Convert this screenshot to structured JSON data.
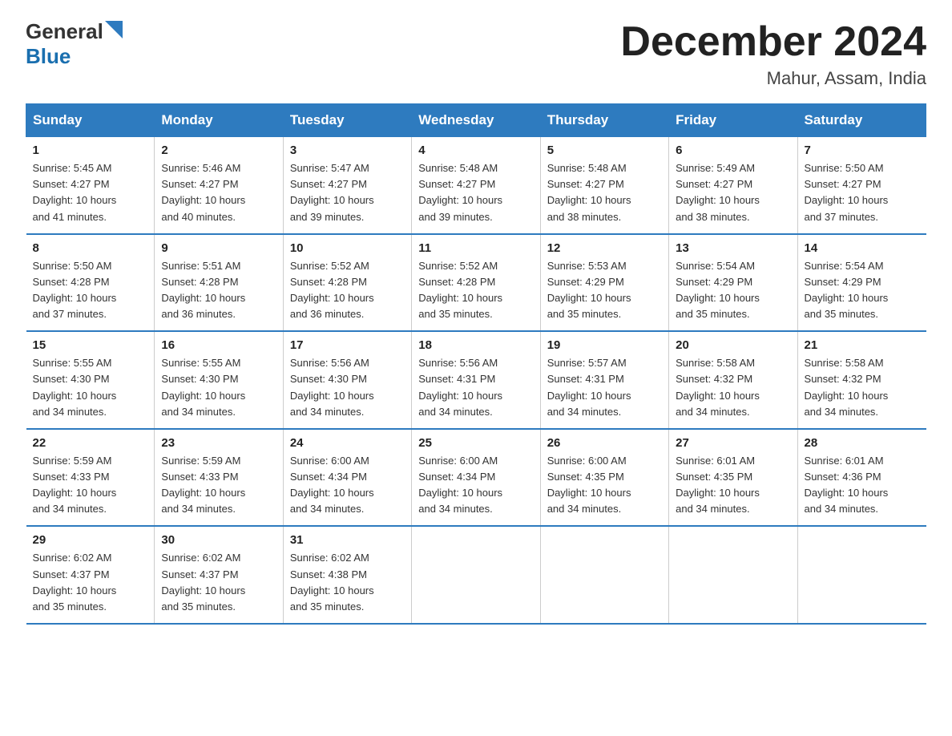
{
  "header": {
    "logo_general": "General",
    "logo_blue": "Blue",
    "month_title": "December 2024",
    "location": "Mahur, Assam, India"
  },
  "days_of_week": [
    "Sunday",
    "Monday",
    "Tuesday",
    "Wednesday",
    "Thursday",
    "Friday",
    "Saturday"
  ],
  "weeks": [
    [
      {
        "day": "1",
        "info": "Sunrise: 5:45 AM\nSunset: 4:27 PM\nDaylight: 10 hours\nand 41 minutes."
      },
      {
        "day": "2",
        "info": "Sunrise: 5:46 AM\nSunset: 4:27 PM\nDaylight: 10 hours\nand 40 minutes."
      },
      {
        "day": "3",
        "info": "Sunrise: 5:47 AM\nSunset: 4:27 PM\nDaylight: 10 hours\nand 39 minutes."
      },
      {
        "day": "4",
        "info": "Sunrise: 5:48 AM\nSunset: 4:27 PM\nDaylight: 10 hours\nand 39 minutes."
      },
      {
        "day": "5",
        "info": "Sunrise: 5:48 AM\nSunset: 4:27 PM\nDaylight: 10 hours\nand 38 minutes."
      },
      {
        "day": "6",
        "info": "Sunrise: 5:49 AM\nSunset: 4:27 PM\nDaylight: 10 hours\nand 38 minutes."
      },
      {
        "day": "7",
        "info": "Sunrise: 5:50 AM\nSunset: 4:27 PM\nDaylight: 10 hours\nand 37 minutes."
      }
    ],
    [
      {
        "day": "8",
        "info": "Sunrise: 5:50 AM\nSunset: 4:28 PM\nDaylight: 10 hours\nand 37 minutes."
      },
      {
        "day": "9",
        "info": "Sunrise: 5:51 AM\nSunset: 4:28 PM\nDaylight: 10 hours\nand 36 minutes."
      },
      {
        "day": "10",
        "info": "Sunrise: 5:52 AM\nSunset: 4:28 PM\nDaylight: 10 hours\nand 36 minutes."
      },
      {
        "day": "11",
        "info": "Sunrise: 5:52 AM\nSunset: 4:28 PM\nDaylight: 10 hours\nand 35 minutes."
      },
      {
        "day": "12",
        "info": "Sunrise: 5:53 AM\nSunset: 4:29 PM\nDaylight: 10 hours\nand 35 minutes."
      },
      {
        "day": "13",
        "info": "Sunrise: 5:54 AM\nSunset: 4:29 PM\nDaylight: 10 hours\nand 35 minutes."
      },
      {
        "day": "14",
        "info": "Sunrise: 5:54 AM\nSunset: 4:29 PM\nDaylight: 10 hours\nand 35 minutes."
      }
    ],
    [
      {
        "day": "15",
        "info": "Sunrise: 5:55 AM\nSunset: 4:30 PM\nDaylight: 10 hours\nand 34 minutes."
      },
      {
        "day": "16",
        "info": "Sunrise: 5:55 AM\nSunset: 4:30 PM\nDaylight: 10 hours\nand 34 minutes."
      },
      {
        "day": "17",
        "info": "Sunrise: 5:56 AM\nSunset: 4:30 PM\nDaylight: 10 hours\nand 34 minutes."
      },
      {
        "day": "18",
        "info": "Sunrise: 5:56 AM\nSunset: 4:31 PM\nDaylight: 10 hours\nand 34 minutes."
      },
      {
        "day": "19",
        "info": "Sunrise: 5:57 AM\nSunset: 4:31 PM\nDaylight: 10 hours\nand 34 minutes."
      },
      {
        "day": "20",
        "info": "Sunrise: 5:58 AM\nSunset: 4:32 PM\nDaylight: 10 hours\nand 34 minutes."
      },
      {
        "day": "21",
        "info": "Sunrise: 5:58 AM\nSunset: 4:32 PM\nDaylight: 10 hours\nand 34 minutes."
      }
    ],
    [
      {
        "day": "22",
        "info": "Sunrise: 5:59 AM\nSunset: 4:33 PM\nDaylight: 10 hours\nand 34 minutes."
      },
      {
        "day": "23",
        "info": "Sunrise: 5:59 AM\nSunset: 4:33 PM\nDaylight: 10 hours\nand 34 minutes."
      },
      {
        "day": "24",
        "info": "Sunrise: 6:00 AM\nSunset: 4:34 PM\nDaylight: 10 hours\nand 34 minutes."
      },
      {
        "day": "25",
        "info": "Sunrise: 6:00 AM\nSunset: 4:34 PM\nDaylight: 10 hours\nand 34 minutes."
      },
      {
        "day": "26",
        "info": "Sunrise: 6:00 AM\nSunset: 4:35 PM\nDaylight: 10 hours\nand 34 minutes."
      },
      {
        "day": "27",
        "info": "Sunrise: 6:01 AM\nSunset: 4:35 PM\nDaylight: 10 hours\nand 34 minutes."
      },
      {
        "day": "28",
        "info": "Sunrise: 6:01 AM\nSunset: 4:36 PM\nDaylight: 10 hours\nand 34 minutes."
      }
    ],
    [
      {
        "day": "29",
        "info": "Sunrise: 6:02 AM\nSunset: 4:37 PM\nDaylight: 10 hours\nand 35 minutes."
      },
      {
        "day": "30",
        "info": "Sunrise: 6:02 AM\nSunset: 4:37 PM\nDaylight: 10 hours\nand 35 minutes."
      },
      {
        "day": "31",
        "info": "Sunrise: 6:02 AM\nSunset: 4:38 PM\nDaylight: 10 hours\nand 35 minutes."
      },
      {
        "day": "",
        "info": ""
      },
      {
        "day": "",
        "info": ""
      },
      {
        "day": "",
        "info": ""
      },
      {
        "day": "",
        "info": ""
      }
    ]
  ]
}
